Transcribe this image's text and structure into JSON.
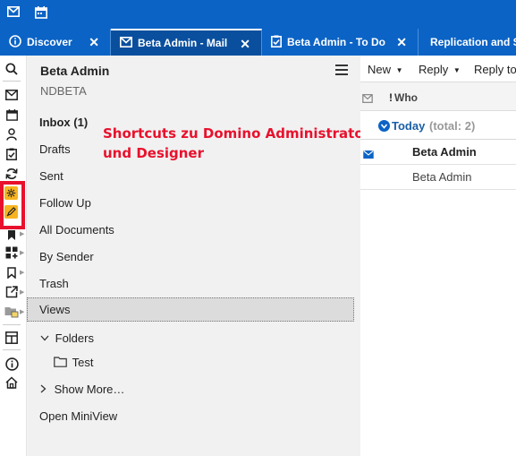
{
  "topbar": {
    "icons": [
      "mail-icon",
      "calendar-icon"
    ]
  },
  "tabs": [
    {
      "label": "Discover",
      "icon": "info-icon",
      "active": false,
      "close": "✕"
    },
    {
      "label": "Beta Admin - Mail",
      "icon": "mail-icon",
      "active": true,
      "close": "✕"
    },
    {
      "label": "Beta Admin - To Do",
      "icon": "todo-icon",
      "active": false,
      "close": "✕"
    },
    {
      "label": "Replication and S",
      "icon": "",
      "active": false,
      "close": ""
    }
  ],
  "sidebar": {
    "icons": [
      "search-icon",
      "mail-icon",
      "calendar-icon",
      "contacts-icon",
      "todo-icon",
      "sync-icon",
      "domino-administrator-icon",
      "domino-designer-icon",
      "bookmark-icon",
      "apps-icon",
      "bookmarks-icon",
      "open-external-icon",
      "workspace-icon",
      "layout-icon",
      "info-icon",
      "home-icon"
    ]
  },
  "nav": {
    "title": "Beta Admin",
    "subtitle": "NDBETA",
    "items": {
      "inbox": "Inbox (1)",
      "drafts": "Drafts",
      "sent": "Sent",
      "followup": "Follow Up",
      "alldocs": "All Documents",
      "bysender": "By Sender",
      "trash": "Trash",
      "views": "Views",
      "folders": "Folders",
      "test": "Test",
      "showmore": "Show More…",
      "miniview": "Open MiniView"
    }
  },
  "annotation": {
    "line1": "Shortcuts zu Domino Administrator",
    "line2": "und Designer"
  },
  "toolbar": {
    "new_label": "New",
    "reply_label": "Reply",
    "reply_to_label": "Reply to"
  },
  "columns": {
    "importance": "!",
    "who": "Who"
  },
  "group": {
    "label": "Today",
    "count": "(total: 2)"
  },
  "messages": [
    {
      "who": "Beta Admin",
      "unread": true
    },
    {
      "who": "Beta Admin",
      "unread": false
    }
  ],
  "colors": {
    "brand_blue": "#0b63c5",
    "active_tab": "#0a4f9e",
    "highlight_red": "#e8112d",
    "shortcut_yellow": "#f7b41f"
  }
}
